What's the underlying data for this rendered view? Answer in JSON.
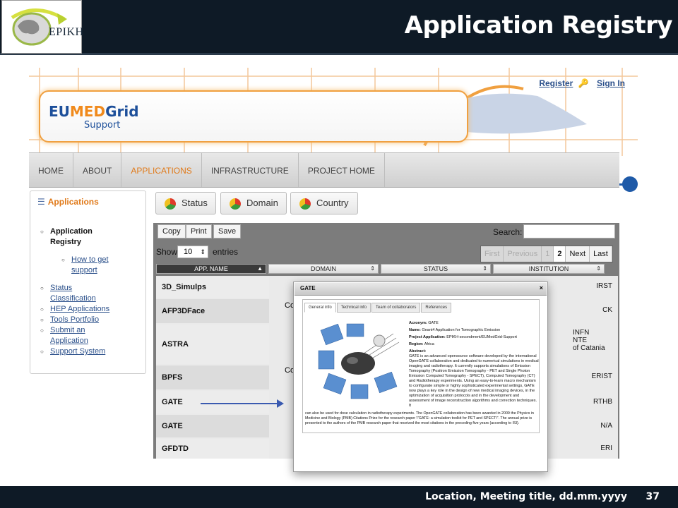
{
  "slide": {
    "title": "Application Registry",
    "logo_text": "EPIKH",
    "footer_text": "Location, Meeting title, dd.mm.yyyy",
    "page_number": "37"
  },
  "site": {
    "logo_eu": "EU",
    "logo_med": "MED",
    "logo_grid": "Grid",
    "logo_support": "Support",
    "register_label": "Register",
    "signin_label": "Sign In"
  },
  "nav": {
    "items": [
      "HOME",
      "ABOUT",
      "APPLICATIONS",
      "INFRASTRUCTURE",
      "PROJECT HOME"
    ],
    "active": "APPLICATIONS"
  },
  "sidebar": {
    "title": "Applications",
    "items": [
      {
        "label": "Application Registry",
        "type": "current"
      },
      {
        "label": "How to get support",
        "type": "sub"
      },
      {
        "label": "Status Classification",
        "type": "link"
      },
      {
        "label": "HEP Applications",
        "type": "link"
      },
      {
        "label": "Tools Portfolio",
        "type": "link"
      },
      {
        "label": "Submit an Application",
        "type": "link"
      },
      {
        "label": "Support System",
        "type": "link"
      }
    ]
  },
  "filters": [
    "Status",
    "Domain",
    "Country"
  ],
  "table": {
    "buttons": [
      "Copy",
      "Print",
      "Save"
    ],
    "search_label": "Search:",
    "show_label": "Show",
    "show_value": "10",
    "entries_label": "entries",
    "pager": [
      "First",
      "Previous",
      "1",
      "2",
      "Next",
      "Last"
    ],
    "columns": [
      "APP. NAME",
      "DOMAIN",
      "STATUS",
      "INSTITUTION"
    ],
    "rows": [
      {
        "name": "3D_Simulps",
        "inst": "IRST"
      },
      {
        "name": "AFP3DFace",
        "inst": "CK"
      },
      {
        "name": "ASTRA",
        "inst": "INFN\nNTE\nof Catania"
      },
      {
        "name": "BPFS",
        "inst": "ERIST"
      },
      {
        "name": "GATE",
        "inst": "RTHB"
      },
      {
        "name": "GATE",
        "inst": "N/A"
      },
      {
        "name": "GFDTD",
        "inst": "ERI"
      }
    ],
    "domain_fragments": [
      "Co",
      "Co"
    ]
  },
  "popup": {
    "title": "GATE",
    "close": "×",
    "tabs": [
      "General info",
      "Technical info",
      "Team of collaborators",
      "References"
    ],
    "acronym_label": "Acronym:",
    "acronym": "GATE",
    "name_label": "Name:",
    "name": "Geant4 Application for Tomographic Emission",
    "project_label": "Project Application:",
    "project": "EPIKH-secondment/EUMedGrid-Support",
    "region_label": "Region:",
    "region": "Africa",
    "abstract_label": "Abstract:",
    "abstract": "GATE is an advanced opensource software developed by the international OpenGATE collaboration and dedicated to numerical simulations in medical imaging and radiotherapy. It currently supports simulations of Emission Tomography (Positron Emission Tomography - PET and Single Photon Emission Computed Tomography - SPECT), Computed Tomography (CT) and Radiotherapy experiments. Using an easy-to-learn macro mechanism to configurate simple or highly sophisticated experimental settings, GATE now plays a key role in the design of new medical imaging devices, in the optimization of acquisition protocols and in the development and assessment of image reconstruction algorithms and correction techniques. It",
    "abstract_cont": "can also be used for dose calculation in radiotherapy experiments. The OpenGATE collaboration has been awarded in 2009 the Physics in Medicine and Biology (PMB) Citations Prize for the research paper \\\"GATE: a simulation toolkit for PET and SPECT\\\". The annual prize is presented to the authors of the PMB research paper that received the most citations in the preceding five years (according to ISI)."
  },
  "colors": {
    "header_bg": "#0e1a26",
    "accent_orange": "#e07a1a",
    "link_blue": "#2a4f8a"
  }
}
